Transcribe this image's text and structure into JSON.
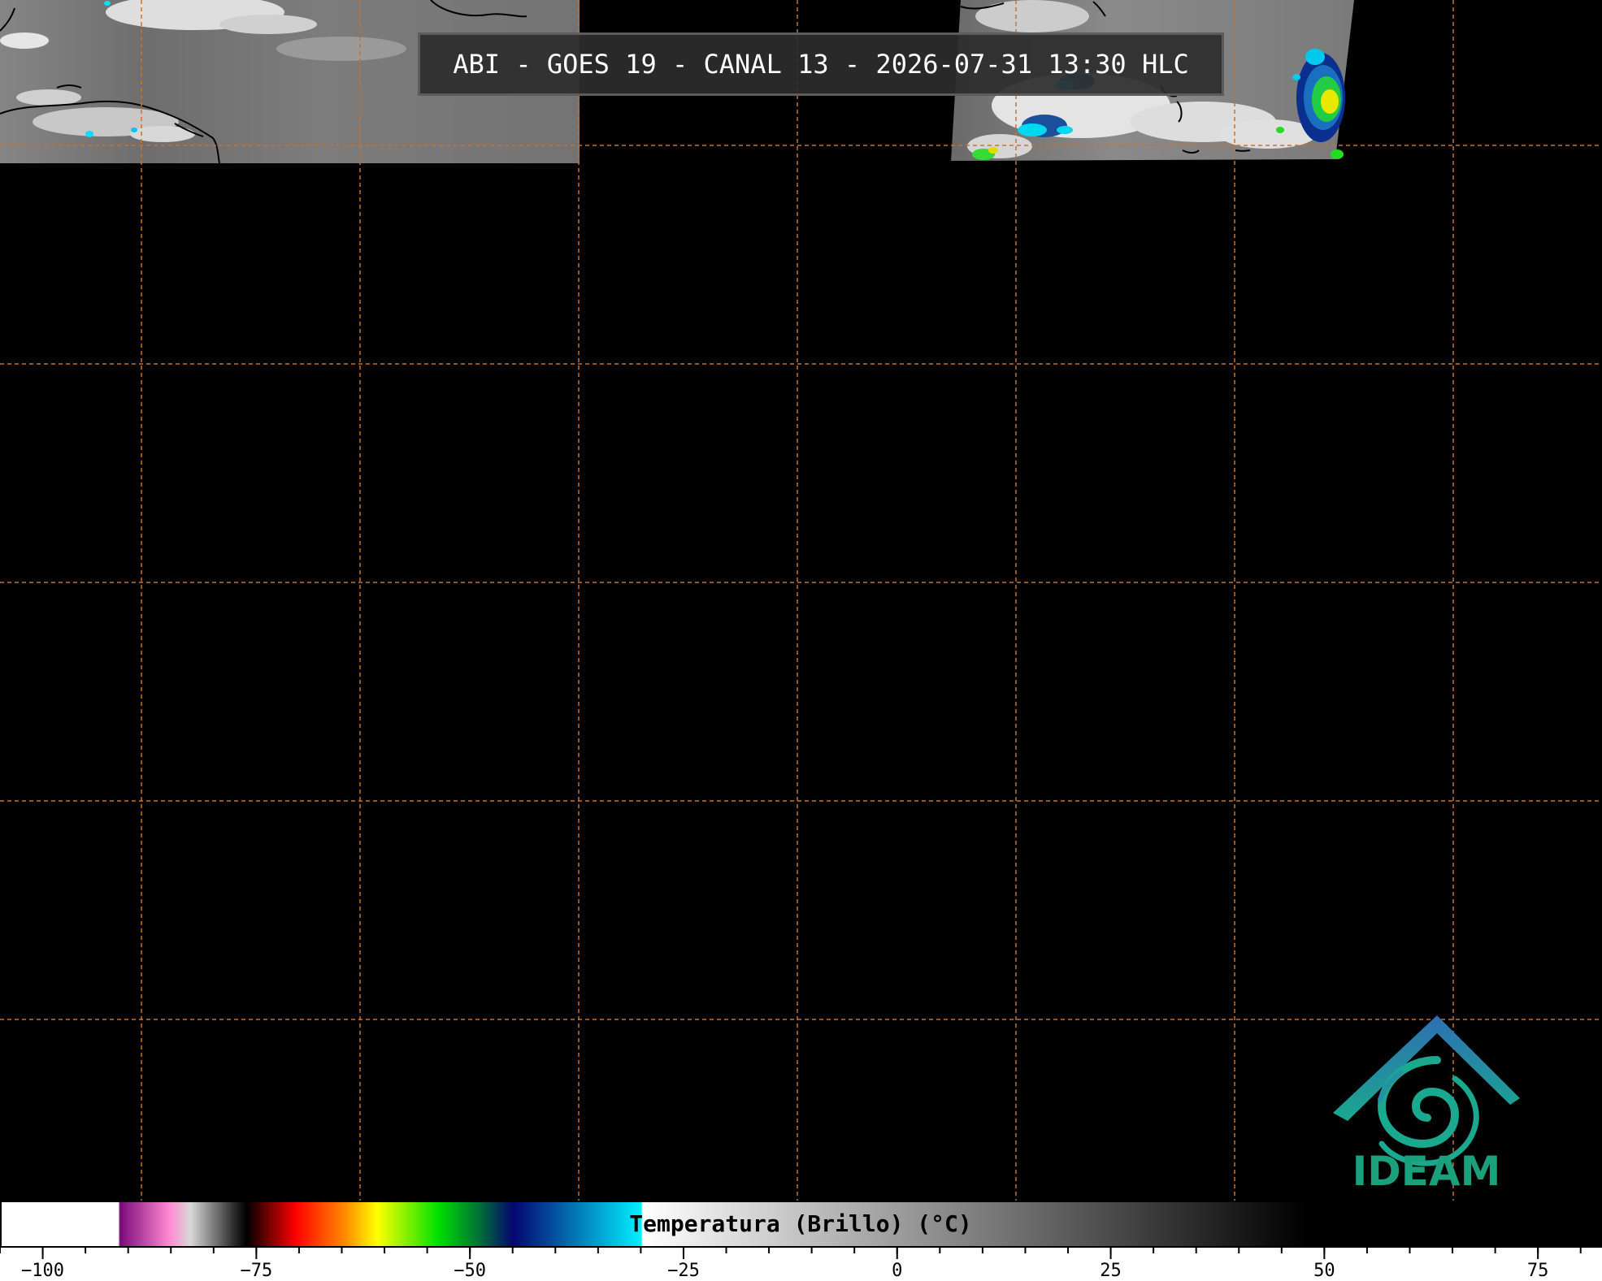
{
  "title": "ABI - GOES 19 - CANAL 13 - 2026-07-31 13:30 HLC",
  "logo": {
    "text": "IDEAM",
    "icon": "ideam-logo-icon"
  },
  "colorbar": {
    "label": "Temperatura (Brillo) (°C)",
    "min": -105,
    "max": 82.5,
    "ticks": [
      {
        "value": -100,
        "label": "−100"
      },
      {
        "value": -75,
        "label": "−75"
      },
      {
        "value": -50,
        "label": "−50"
      },
      {
        "value": -25,
        "label": "−25"
      },
      {
        "value": 0,
        "label": "0"
      },
      {
        "value": 25,
        "label": "25"
      },
      {
        "value": 50,
        "label": "50"
      },
      {
        "value": 75,
        "label": "75"
      }
    ],
    "colors": {
      "white": "#ffffff",
      "magenta": "#8a0f8a",
      "pink": "#ff8ad2",
      "red": "#ff0000",
      "orange": "#ff8c00",
      "yellow": "#ffff00",
      "green": "#00e000",
      "navy": "#050570",
      "cyan": "#00f0ff",
      "black": "#000000"
    }
  },
  "map_colors": {
    "grid": "#c8732e",
    "coast": "#000000",
    "cloud_bright": "#e0e0e0",
    "cloud_dark": "#555555"
  }
}
